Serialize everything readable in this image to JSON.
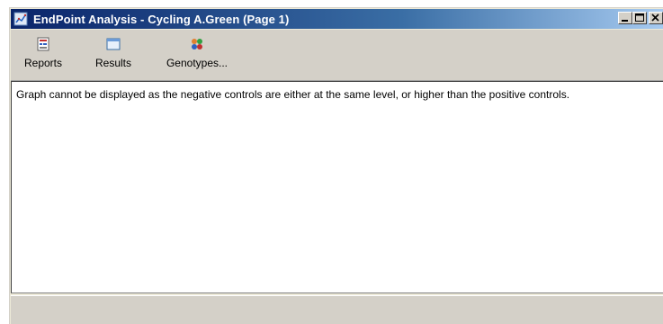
{
  "window": {
    "title": "EndPoint Analysis - Cycling A.Green (Page 1)",
    "icon": "chart-window-icon"
  },
  "titlebar_buttons": {
    "minimize": "minimize-icon",
    "maximize": "maximize-icon",
    "close": "close-icon"
  },
  "toolbar": {
    "reports_label": "Reports",
    "results_label": "Results",
    "genotypes_label": "Genotypes..."
  },
  "content": {
    "message": "Graph cannot be displayed as the negative controls are either at the same level, or higher than the positive controls."
  },
  "colors": {
    "titlebar_start": "#0a246a",
    "titlebar_end": "#a6caf0",
    "chrome": "#d4d0c8",
    "content_bg": "#ffffff"
  }
}
